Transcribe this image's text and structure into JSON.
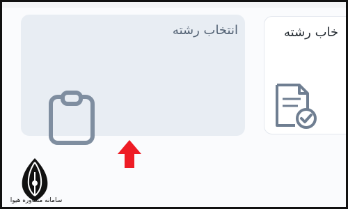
{
  "cards": [
    {
      "label": "انتخاب رشته",
      "icon": "clipboard-icon",
      "state": "selected"
    },
    {
      "label": "خاب رشته",
      "icon": "document-check-icon",
      "state": "default"
    }
  ],
  "brand": {
    "name": "سامانه مشاوره هیوا",
    "logo": "pen-nib-logo-icon"
  },
  "colors": {
    "selected_card": "#e8edf3",
    "icon": "#7f8ea0",
    "arrow": "#ee1c25",
    "border": "#111111"
  }
}
